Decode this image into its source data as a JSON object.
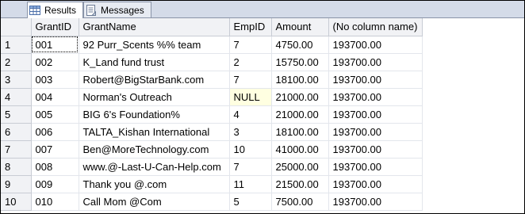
{
  "tabs": [
    {
      "label": "Results",
      "icon": "grid-icon",
      "active": true
    },
    {
      "label": "Messages",
      "icon": "messages-icon",
      "active": false
    }
  ],
  "columns": [
    "GrantID",
    "GrantName",
    "EmpID",
    "Amount",
    "(No column name)"
  ],
  "rows": [
    {
      "num": "1",
      "cells": [
        "001",
        "92 Purr_Scents %% team",
        "7",
        "4750.00",
        "193700.00"
      ]
    },
    {
      "num": "2",
      "cells": [
        "002",
        "K_Land fund trust",
        "2",
        "15750.00",
        "193700.00"
      ]
    },
    {
      "num": "3",
      "cells": [
        "003",
        "Robert@BigStarBank.com",
        "7",
        "18100.00",
        "193700.00"
      ]
    },
    {
      "num": "4",
      "cells": [
        "004",
        "Norman's Outreach",
        "NULL",
        "21000.00",
        "193700.00"
      ]
    },
    {
      "num": "5",
      "cells": [
        "005",
        "BIG 6's Foundation%",
        "4",
        "21000.00",
        "193700.00"
      ]
    },
    {
      "num": "6",
      "cells": [
        "006",
        "TALTA_Kishan International",
        "3",
        "18100.00",
        "193700.00"
      ]
    },
    {
      "num": "7",
      "cells": [
        "007",
        "Ben@MoreTechnology.com",
        "10",
        "41000.00",
        "193700.00"
      ]
    },
    {
      "num": "8",
      "cells": [
        "008",
        "www.@-Last-U-Can-Help.com",
        "7",
        "25000.00",
        "193700.00"
      ]
    },
    {
      "num": "9",
      "cells": [
        "009",
        "Thank you @.com",
        "11",
        "21500.00",
        "193700.00"
      ]
    },
    {
      "num": "10",
      "cells": [
        "010",
        "Call Mom @Com",
        "5",
        "7500.00",
        "193700.00"
      ]
    }
  ],
  "colors": {
    "null_highlight": "#ffffe1",
    "header_bg": "#f1f2f5",
    "tabbar_bg": "#d4dbe8"
  }
}
